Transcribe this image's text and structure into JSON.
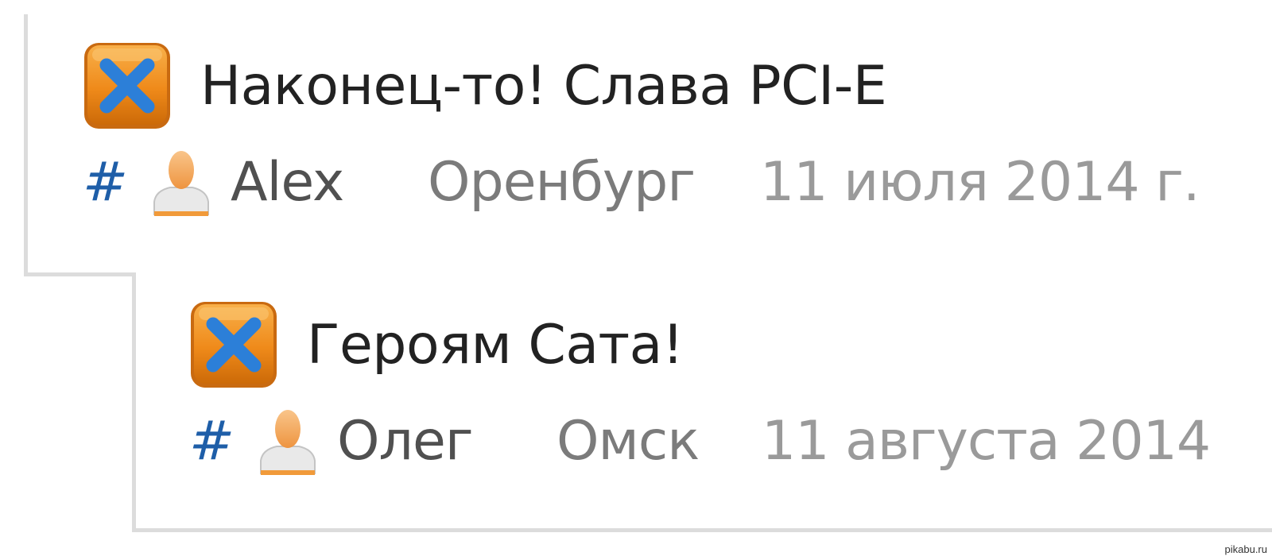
{
  "comments": [
    {
      "text": "Наконец-то! Слава PCI-E",
      "anchor": "#",
      "author": "Alex",
      "city": "Оренбург",
      "date": "11 июля 2014 г."
    },
    {
      "text": "Героям Сата!",
      "anchor": "#",
      "author": "Олег",
      "city": "Омск",
      "date": "11 августа 2014"
    }
  ],
  "icons": {
    "status_badge": "orange-badge-blue-x-icon",
    "user_avatar": "user-silhouette-icon"
  },
  "colors": {
    "anchor": "#1e5ea8",
    "badge_orange": "#f08a1c",
    "badge_x": "#2c7fd8",
    "thread_line": "#dcdcdc"
  },
  "watermark": "pikabu.ru"
}
